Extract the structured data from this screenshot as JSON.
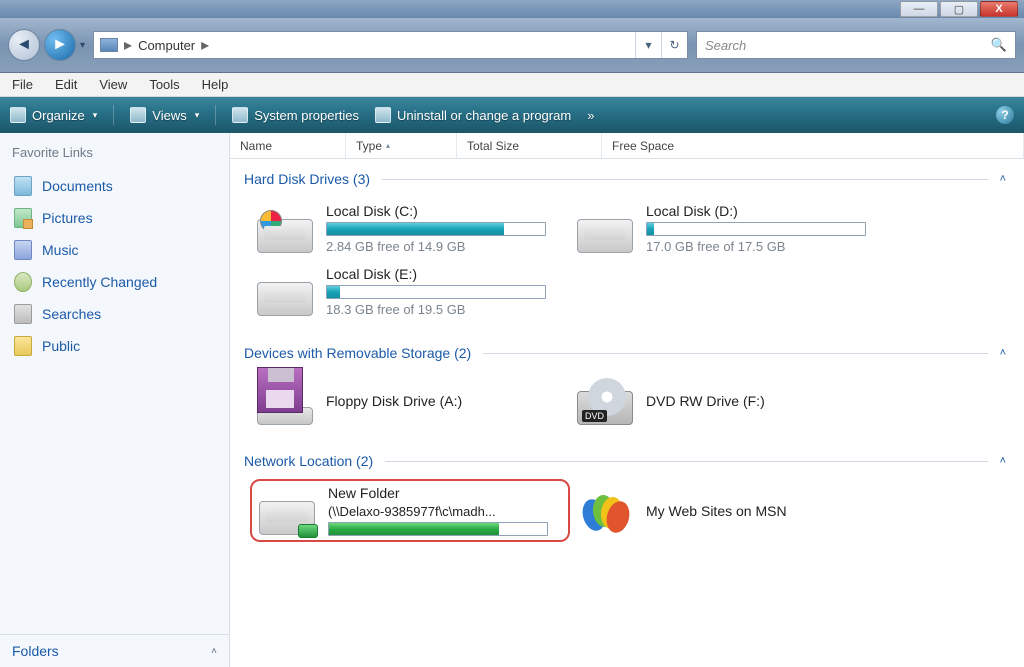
{
  "window": {
    "min": "—",
    "max": "▢",
    "close": "X"
  },
  "nav": {
    "back_glyph": "◄",
    "fwd_glyph": "►",
    "dd_glyph": "▾",
    "refresh_glyph": "↻"
  },
  "address": {
    "location": "Computer",
    "sep": "▸"
  },
  "search": {
    "placeholder": "Search",
    "mag": "🔍"
  },
  "menu": {
    "file": "File",
    "edit": "Edit",
    "view": "View",
    "tools": "Tools",
    "help": "Help"
  },
  "cmd": {
    "organize": "Organize",
    "views": "Views",
    "sysprops": "System properties",
    "uninstall": "Uninstall or change a program",
    "more": "»",
    "help": "?"
  },
  "sidebar": {
    "header": "Favorite Links",
    "links": {
      "documents": "Documents",
      "pictures": "Pictures",
      "music": "Music",
      "recent": "Recently Changed",
      "searches": "Searches",
      "public": "Public"
    },
    "folders": "Folders",
    "chev": "˄"
  },
  "columns": {
    "name": "Name",
    "type": "Type",
    "total": "Total Size",
    "free": "Free Space"
  },
  "groups": {
    "hdd": {
      "label": "Hard Disk Drives (3)",
      "collapse": "˄"
    },
    "removable": {
      "label": "Devices with Removable Storage (2)",
      "collapse": "˄"
    },
    "network": {
      "label": "Network Location (2)",
      "collapse": "˄"
    }
  },
  "drives": {
    "c": {
      "title": "Local Disk (C:)",
      "free": "2.84 GB free of 14.9 GB",
      "fill_pct": 81
    },
    "d": {
      "title": "Local Disk (D:)",
      "free": "17.0 GB free of 17.5 GB",
      "fill_pct": 3
    },
    "e": {
      "title": "Local Disk (E:)",
      "free": "18.3 GB free of 19.5 GB",
      "fill_pct": 6
    },
    "floppy": {
      "title": "Floppy Disk Drive (A:)"
    },
    "dvd": {
      "title": "DVD RW Drive (F:)"
    },
    "net": {
      "title": "New Folder",
      "sub": "(\\\\Delaxo-9385977f\\c\\madh...",
      "fill_pct": 78
    },
    "msn": {
      "title": "My Web Sites on MSN"
    }
  }
}
